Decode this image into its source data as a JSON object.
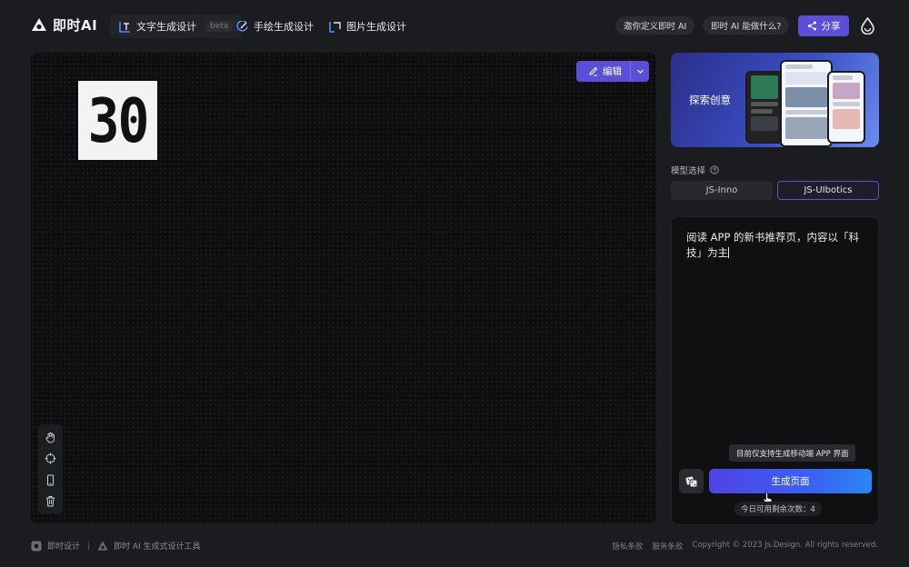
{
  "header": {
    "brand": "即时AI",
    "tabs": [
      {
        "label": "文字生成设计",
        "badge": "beta",
        "icon": "text-design-icon"
      },
      {
        "label": "手绘生成设计",
        "icon": "sketch-icon"
      },
      {
        "label": "图片生成设计",
        "icon": "image-design-icon"
      }
    ],
    "invite_label": "邀你定义即时 AI",
    "what_label": "即时 AI 能做什么?",
    "share_label": "分享"
  },
  "canvas": {
    "thumbnail_number": "30",
    "edit_label": "编辑"
  },
  "banner": {
    "text": "探索创意"
  },
  "model": {
    "label": "模型选择",
    "options": [
      "JS-Inno",
      "JS-UIbotics"
    ],
    "selected": "JS-UIbotics"
  },
  "prompt": {
    "text": "阅读 APP 的新书推荐页，内容以「科技」为主",
    "tip": "目前仅支持生成移动端 APP 界面",
    "generate_label": "生成页面",
    "remaining": "今日可用剩余次数：4"
  },
  "footer": {
    "brand": "即时设计",
    "tool": "即时 AI 生成式设计工具",
    "links": [
      "隐私条款",
      "服务条款"
    ],
    "copyright": "Copyright © 2023 Js.Design. All rights reserved."
  },
  "colors": {
    "accent": "#5a4fd6",
    "background": "#1b1c1f",
    "canvas": "#0e0e10"
  }
}
